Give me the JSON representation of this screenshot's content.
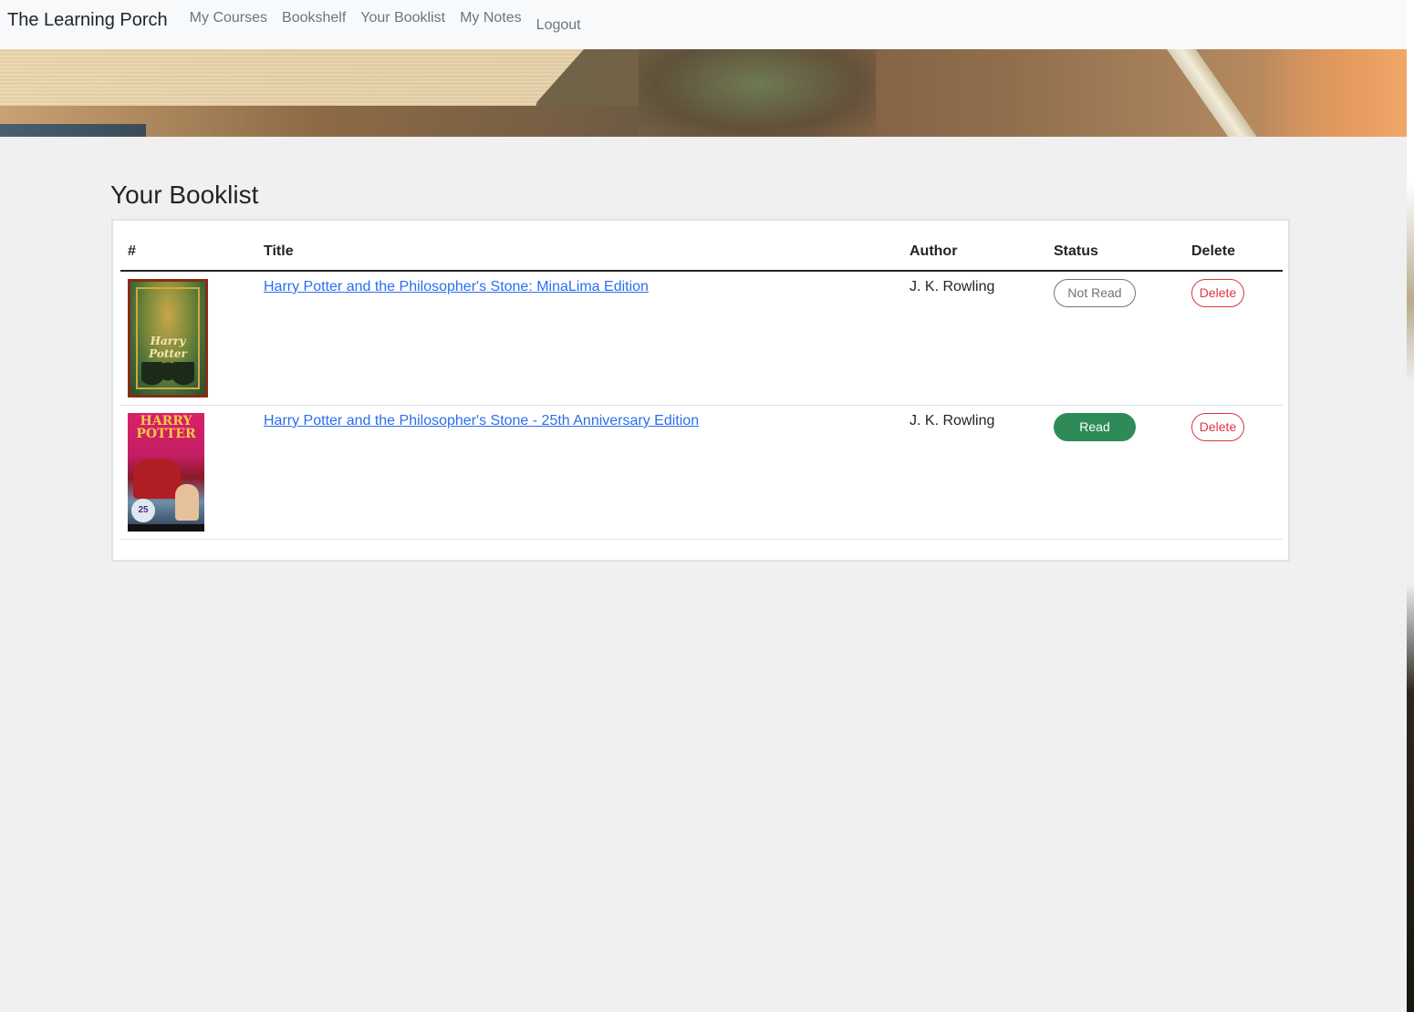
{
  "navbar": {
    "brand": "The Learning Porch",
    "links": [
      "My Courses",
      "Bookshelf",
      "Your Booklist",
      "My Notes",
      "Logout"
    ]
  },
  "main": {
    "heading": "Your Booklist",
    "table": {
      "headers": [
        "#",
        "Title",
        "Author",
        "Status",
        "Delete"
      ],
      "rows": [
        {
          "title": "Harry Potter and the Philosopher's Stone: MinaLima Edition",
          "author": "J. K. Rowling",
          "status": "Not Read",
          "delete": "Delete",
          "cover_text": "Harry Potter",
          "cover_small": "J.K. ROWLING"
        },
        {
          "title": "Harry Potter and the Philosopher's Stone - 25th Anniversary Edition",
          "author": "J. K. Rowling",
          "status": "Read",
          "delete": "Delete",
          "cover_text1": "HARRY",
          "cover_text2": "POTTER",
          "cover_badge": "25"
        }
      ]
    }
  },
  "colors": {
    "link": "#2a6ef0",
    "read": "#2e8b57",
    "not_read": "#6c757d",
    "delete": "#dc3545",
    "page_bg": "#f0f0f0",
    "navbar_bg": "#f8f9fa"
  }
}
